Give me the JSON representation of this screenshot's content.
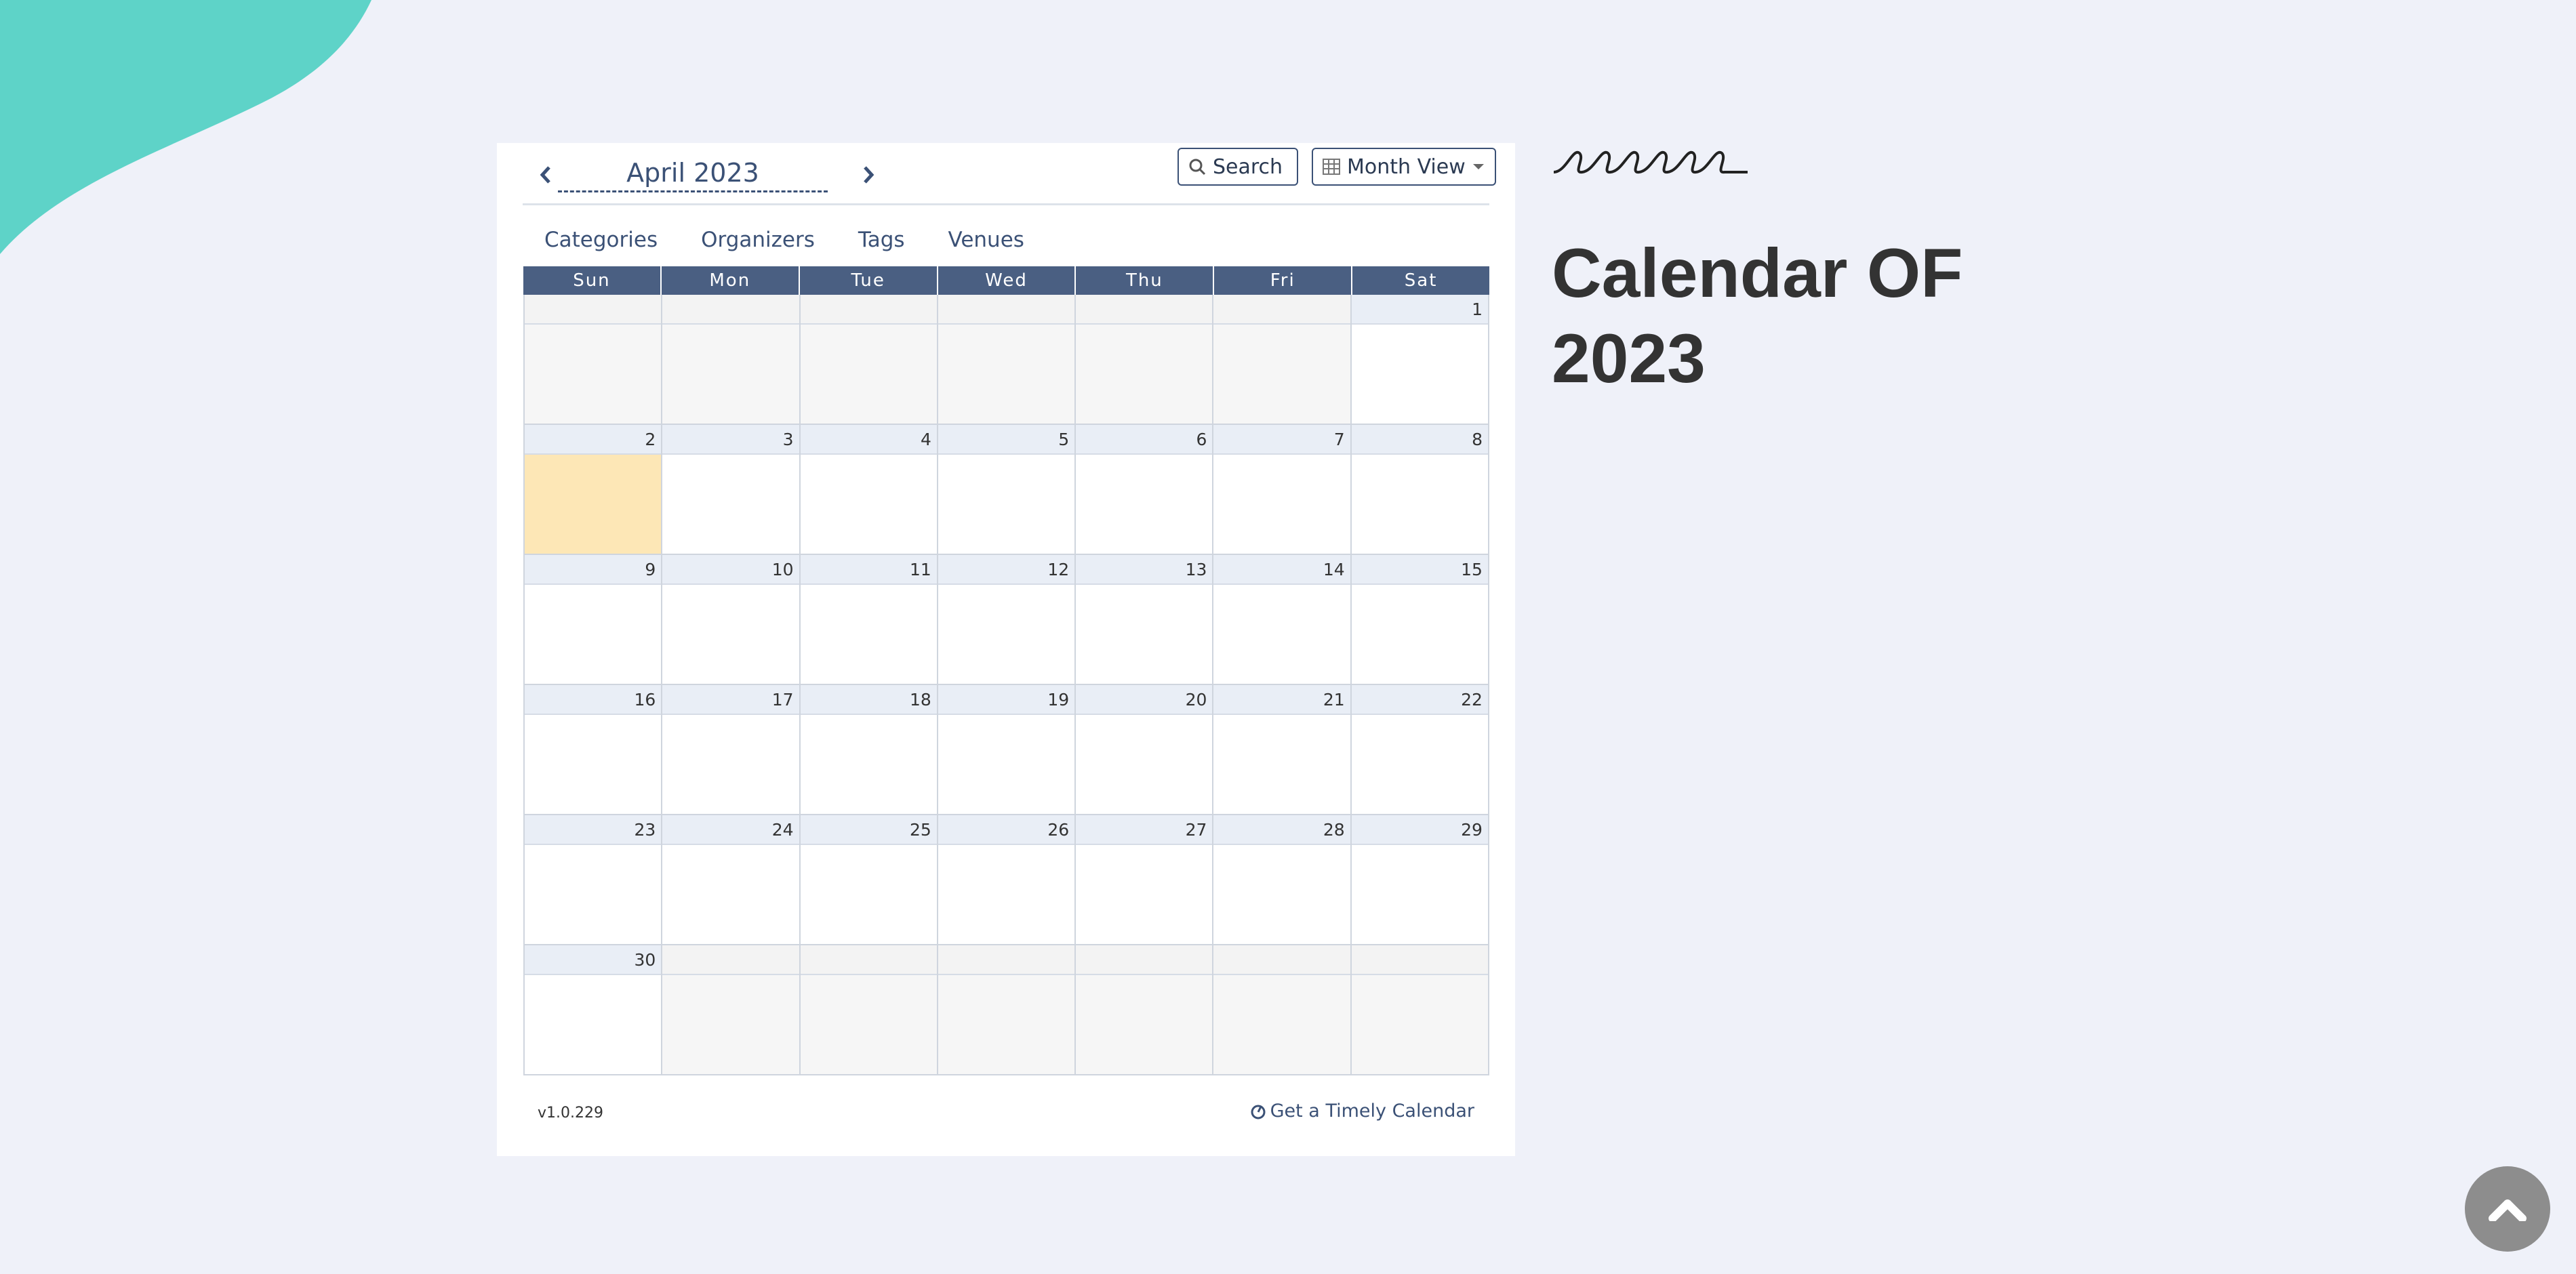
{
  "colors": {
    "background": "#eff1f9",
    "blob": "#5ed3c8",
    "header_bar": "#4a5f82",
    "accent_text": "#3b5176",
    "today": "#fde7b6",
    "scroll_button": "#8d8d8d"
  },
  "calendar": {
    "month_title": "April 2023",
    "prev_icon": "chevron-left-icon",
    "next_icon": "chevron-right-icon",
    "search_label": "Search",
    "view_label": "Month View",
    "filters": [
      "Categories",
      "Organizers",
      "Tags",
      "Venues"
    ],
    "weekdays": [
      "Sun",
      "Mon",
      "Tue",
      "Wed",
      "Thu",
      "Fri",
      "Sat"
    ],
    "weeks": [
      [
        "",
        "",
        "",
        "",
        "",
        "",
        "1"
      ],
      [
        "2",
        "3",
        "4",
        "5",
        "6",
        "7",
        "8"
      ],
      [
        "9",
        "10",
        "11",
        "12",
        "13",
        "14",
        "15"
      ],
      [
        "16",
        "17",
        "18",
        "19",
        "20",
        "21",
        "22"
      ],
      [
        "23",
        "24",
        "25",
        "26",
        "27",
        "28",
        "29"
      ],
      [
        "30",
        "",
        "",
        "",
        "",
        "",
        ""
      ]
    ],
    "today": "2",
    "version": "v1.0.229",
    "timely_link": "Get a Timely Calendar"
  },
  "side": {
    "title": "Calendar OF 2023"
  },
  "scroll_top_icon": "chevron-up-icon"
}
